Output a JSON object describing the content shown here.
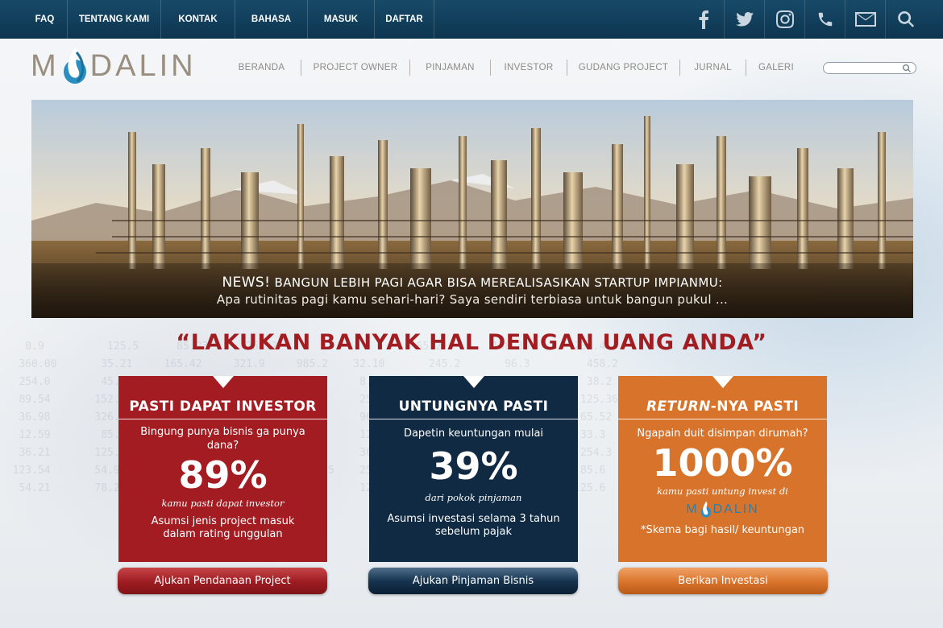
{
  "topbar": {
    "items": [
      {
        "label": "FAQ"
      },
      {
        "label": "TENTANG KAMI"
      },
      {
        "label": "KONTAK"
      },
      {
        "label": "BAHASA"
      },
      {
        "label": "MASUK"
      },
      {
        "label": "DAFTAR"
      }
    ],
    "icons": [
      "facebook-icon",
      "twitter-icon",
      "instagram-icon",
      "phone-icon",
      "mail-icon",
      "search-icon"
    ],
    "colors": {
      "background": "#0d3550",
      "text": "#ffffff"
    }
  },
  "logo": {
    "text_left": "M",
    "text_right": "DALIN"
  },
  "nav": {
    "items": [
      {
        "label": "BERANDA"
      },
      {
        "label": "PROJECT OWNER"
      },
      {
        "label": "PINJAMAN"
      },
      {
        "label": "INVESTOR"
      },
      {
        "label": "GUDANG PROJECT"
      },
      {
        "label": "JURNAL"
      },
      {
        "label": "GALERI"
      }
    ],
    "search_placeholder": ""
  },
  "hero": {
    "news_tag": "NEWS!",
    "headline": "BANGUN LEBIH PAGI AGAR BISA MEREALISASIKAN STARTUP IMPIANMU:",
    "excerpt": "Apa rutinitas pagi kamu sehari-hari? Saya sendiri terbiasa untuk bangun pukul ..."
  },
  "slogan": "“LAKUKAN BANYAK HAL DENGAN UANG ANDA”",
  "cards": [
    {
      "title": "PASTI DAPAT INVESTOR",
      "question": "Bingung punya bisnis ga punya dana?",
      "big": "89%",
      "sub": "kamu pasti dapat investor",
      "note": "Asumsi jenis project masuk dalam rating unggulan",
      "button": "Ajukan Pendanaan Project",
      "color": "#a21c21"
    },
    {
      "title": "UNTUNGNYA PASTI",
      "question": "Dapetin keuntungan mulai",
      "big": "39%",
      "sub": "dari pokok pinjaman",
      "note": "Asumsi investasi selama 3 tahun sebelum pajak",
      "button": "Ajukan Pinjaman Bisnis",
      "color": "#0f2a42"
    },
    {
      "title_italic": "RETURN",
      "title_rest": "-NYA PASTI",
      "question": "Ngapain duit disimpan dirumah?",
      "big": "1000%",
      "sub": "kamu pasti untung invest di",
      "logo_left": "M",
      "logo_right": "DALIN",
      "note": "*Skema bagi hasil/ keuntungan",
      "button": "Berikan Investasi",
      "color": "#d8732b"
    }
  ]
}
